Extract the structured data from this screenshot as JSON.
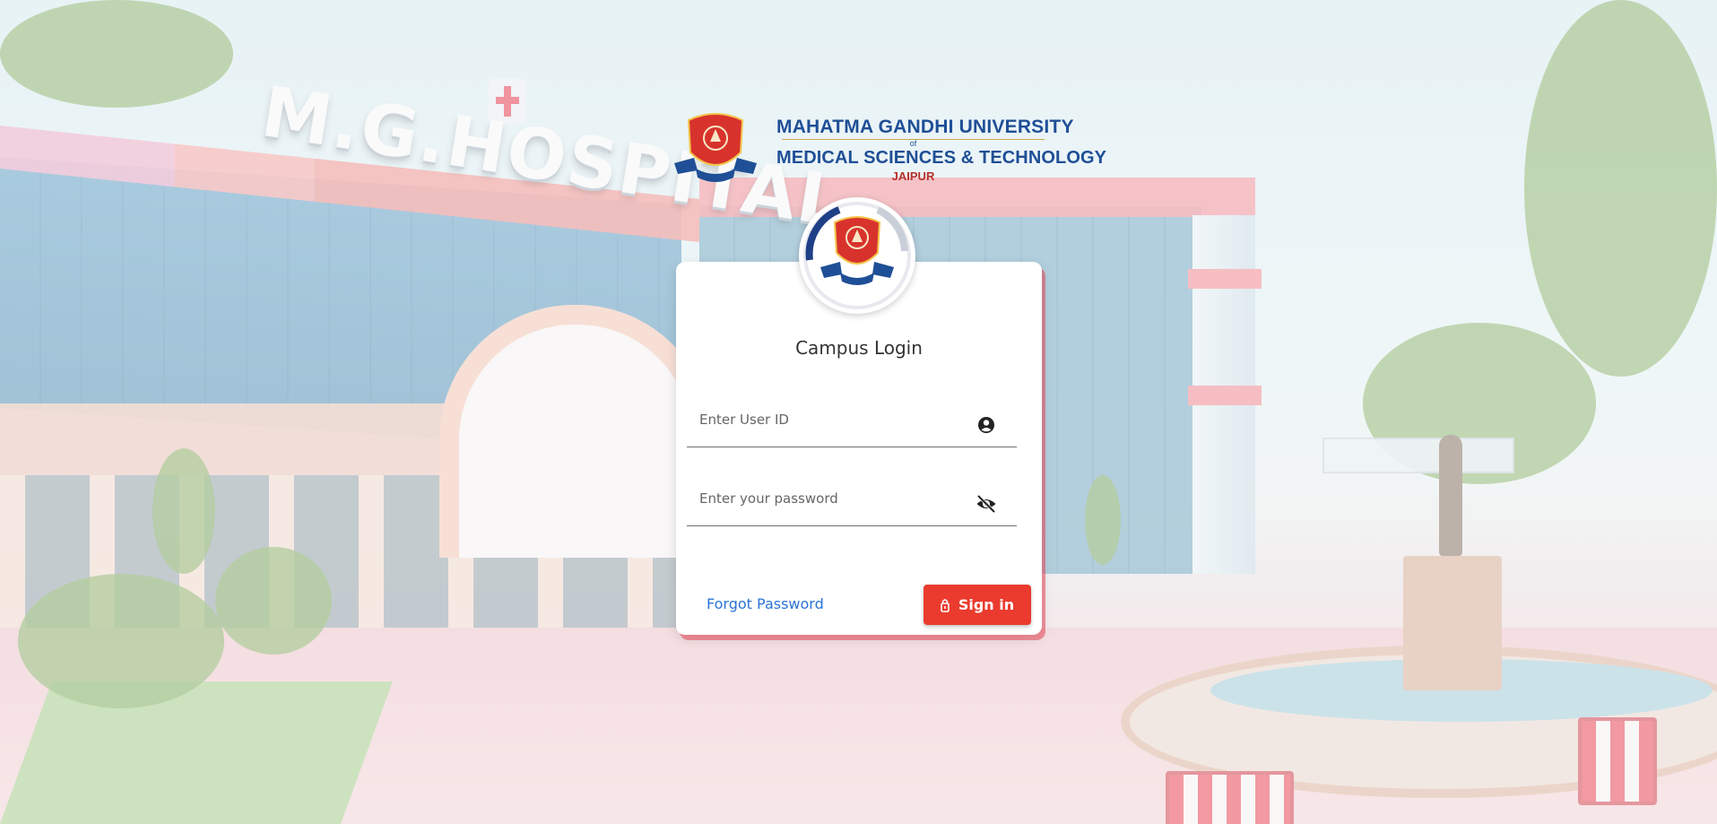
{
  "background": {
    "hospital_sign": "M.G.HOSPITAL"
  },
  "university": {
    "line1": "MAHATMA GANDHI UNIVERSITY",
    "of": "of",
    "line2": "MEDICAL SCIENCES & TECHNOLOGY",
    "city": "JAIPUR"
  },
  "login": {
    "title": "Campus Login",
    "user_id_placeholder": "Enter User ID",
    "user_id_value": "",
    "password_placeholder": "Enter your password",
    "password_value": "",
    "forgot_label": "Forgot Password",
    "signin_label": "Sign in",
    "icons": {
      "user": "user-circle-icon",
      "password": "eye-slash-icon",
      "signin": "lock-icon"
    }
  },
  "colors": {
    "accent": "#ea3b2e",
    "link": "#2a73d6",
    "brand_blue": "#1f4f96",
    "card_shadow": "#e14655"
  }
}
